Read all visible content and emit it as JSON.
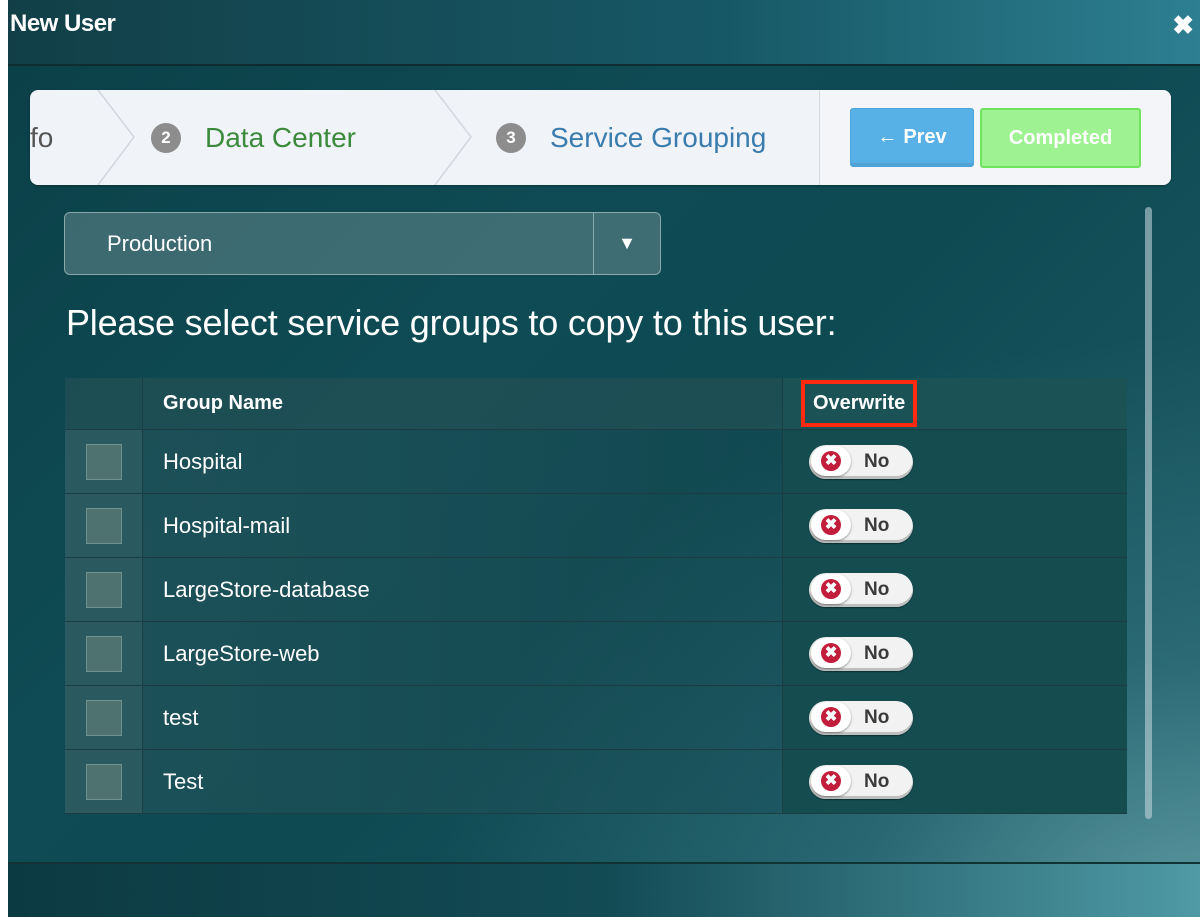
{
  "dialog": {
    "title": "New User",
    "close_glyph": "✖"
  },
  "wizard": {
    "previous_step_partial": "fo",
    "steps": [
      {
        "number": "2",
        "label": "Data Center",
        "state": "done"
      },
      {
        "number": "3",
        "label": "Service Grouping",
        "state": "active"
      }
    ],
    "prev_label": "Prev",
    "prev_icon": "←",
    "completed_label": "Completed"
  },
  "environment_select": {
    "value": "Production",
    "caret_icon": "▼"
  },
  "prompt": "Please select service groups to copy to this user:",
  "table": {
    "columns": {
      "name": "Group Name",
      "overwrite": "Overwrite"
    },
    "rows": [
      {
        "name": "Hospital",
        "overwrite": "No"
      },
      {
        "name": "Hospital-mail",
        "overwrite": "No"
      },
      {
        "name": "LargeStore-database",
        "overwrite": "No"
      },
      {
        "name": "LargeStore-web",
        "overwrite": "No"
      },
      {
        "name": "test",
        "overwrite": "No"
      },
      {
        "name": "Test",
        "overwrite": "No"
      }
    ]
  },
  "colors": {
    "highlight_box": "#ff2a10",
    "prev_button": "#57b0e6",
    "completed_button": "#9ff292",
    "step_done": "#3c8a3c",
    "step_active": "#3a7cad",
    "toggle_off_icon": "#c21d3a"
  }
}
